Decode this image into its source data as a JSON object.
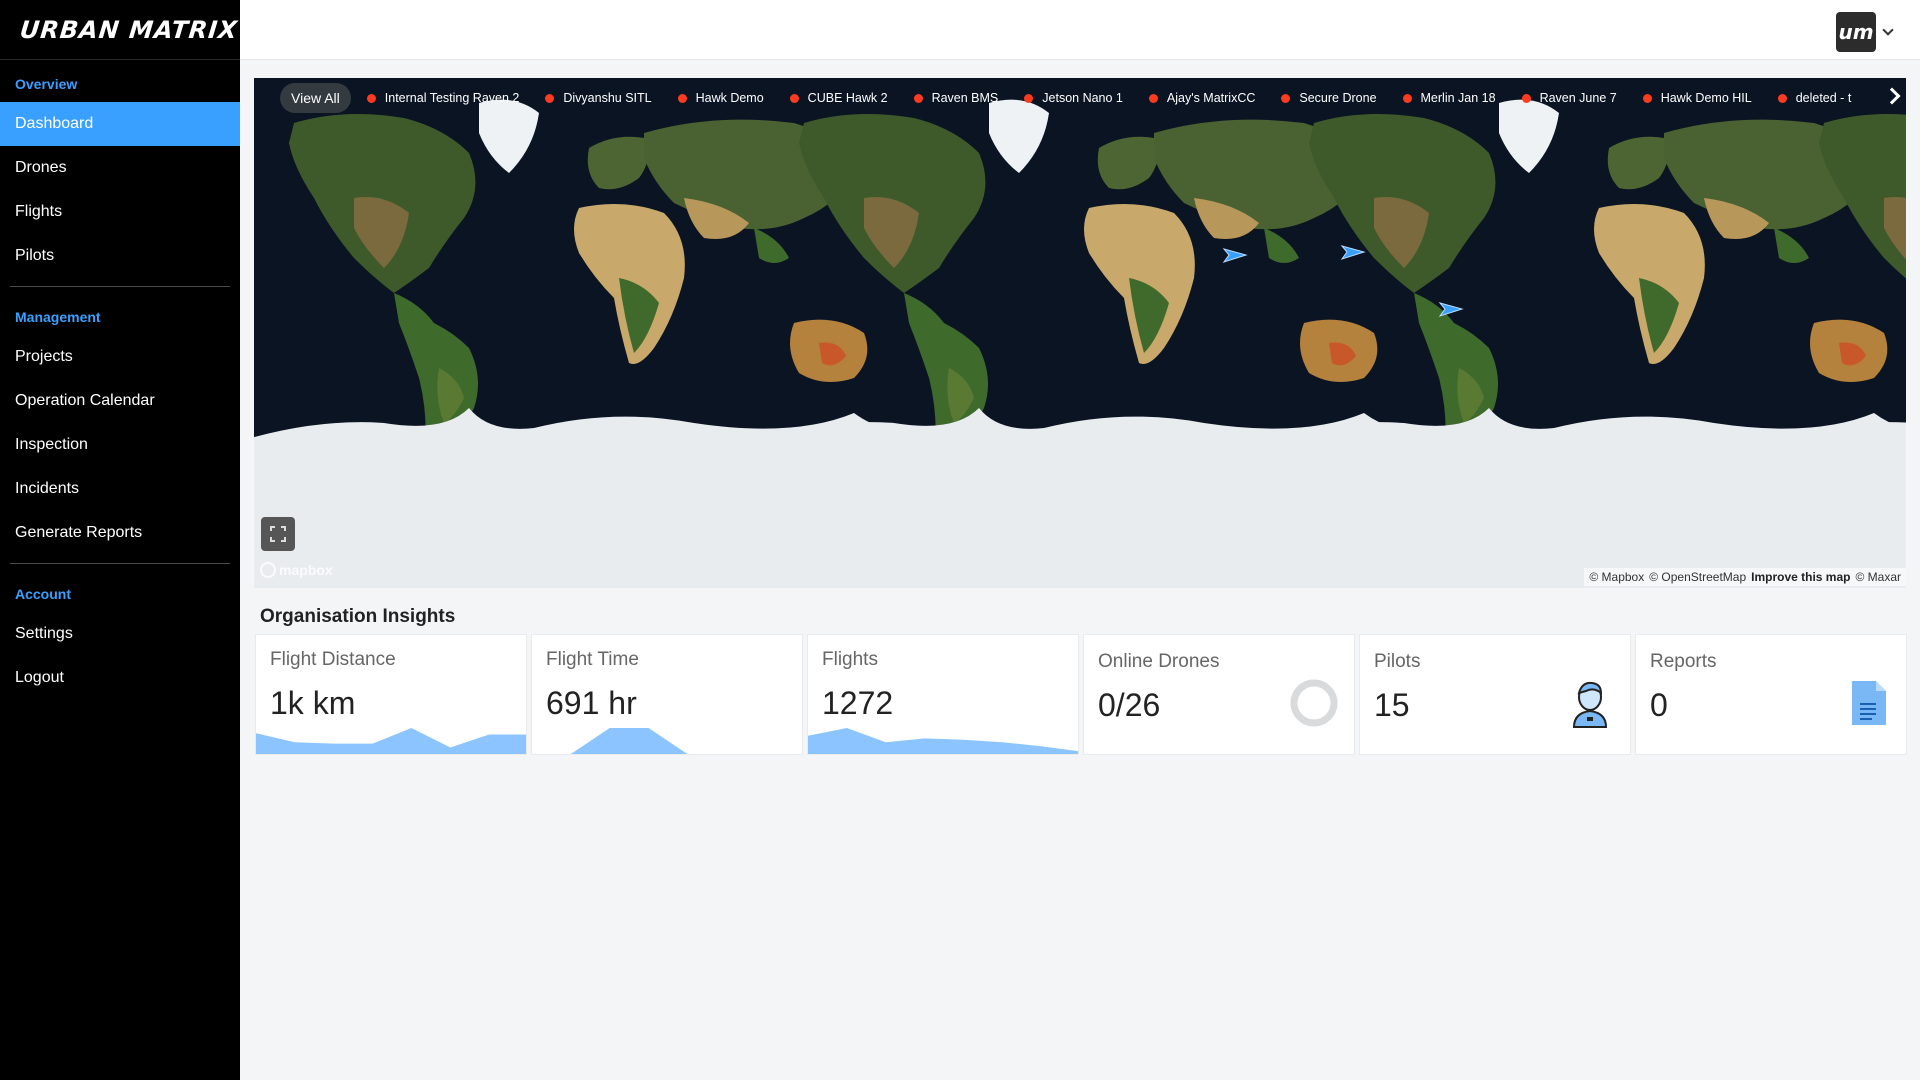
{
  "sidebar": {
    "logo": "URBAN MATRIX",
    "sections": [
      {
        "title": "Overview",
        "items": [
          "Dashboard",
          "Drones",
          "Flights",
          "Pilots"
        ]
      },
      {
        "title": "Management",
        "items": [
          "Projects",
          "Operation Calendar",
          "Inspection",
          "Incidents",
          "Generate Reports"
        ]
      },
      {
        "title": "Account",
        "items": [
          "Settings",
          "Logout"
        ]
      }
    ],
    "active_item": "Dashboard"
  },
  "header": {
    "avatar_text": "um"
  },
  "map": {
    "view_all_label": "View All",
    "drones": [
      "Internal Testing Raven 2",
      "Divyanshu SITL",
      "Hawk Demo",
      "CUBE Hawk 2",
      "Raven BMS",
      "Jetson Nano 1",
      "Ajay's MatrixCC",
      "Secure Drone",
      "Merlin Jan 18",
      "Raven June 7",
      "Hawk Demo HIL",
      "deleted - t"
    ],
    "drone_status_color": "#ff3b1f",
    "logo_text": "mapbox",
    "attribution": {
      "mapbox": "© Mapbox",
      "osm": "© OpenStreetMap",
      "improve": "Improve this map",
      "maxar": "© Maxar"
    }
  },
  "insights": {
    "title": "Organisation Insights",
    "cards": [
      {
        "label": "Flight Distance",
        "value": "1k km",
        "trend": [
          0.8,
          0.45,
          0.4,
          0.4,
          1.0,
          0.25,
          0.75,
          0.75
        ]
      },
      {
        "label": "Flight Time",
        "value": "691 hr",
        "trend": [
          0.0,
          0.0,
          1.0,
          1.0,
          0.0,
          0.0,
          0.0,
          0.0
        ]
      },
      {
        "label": "Flights",
        "value": "1272",
        "trend": [
          0.7,
          1.0,
          0.45,
          0.6,
          0.55,
          0.45,
          0.3,
          0.1
        ]
      },
      {
        "label": "Online Drones",
        "value": "0/26",
        "online": 0,
        "total": 26
      },
      {
        "label": "Pilots",
        "value": "15",
        "icon": "pilot-icon"
      },
      {
        "label": "Reports",
        "value": "0",
        "icon": "document-icon"
      }
    ]
  },
  "colors": {
    "accent": "#3aa0ff",
    "spark_fill": "#8cc4ff",
    "sidebar_bg": "#000000",
    "page_bg": "#f3f5f7"
  }
}
